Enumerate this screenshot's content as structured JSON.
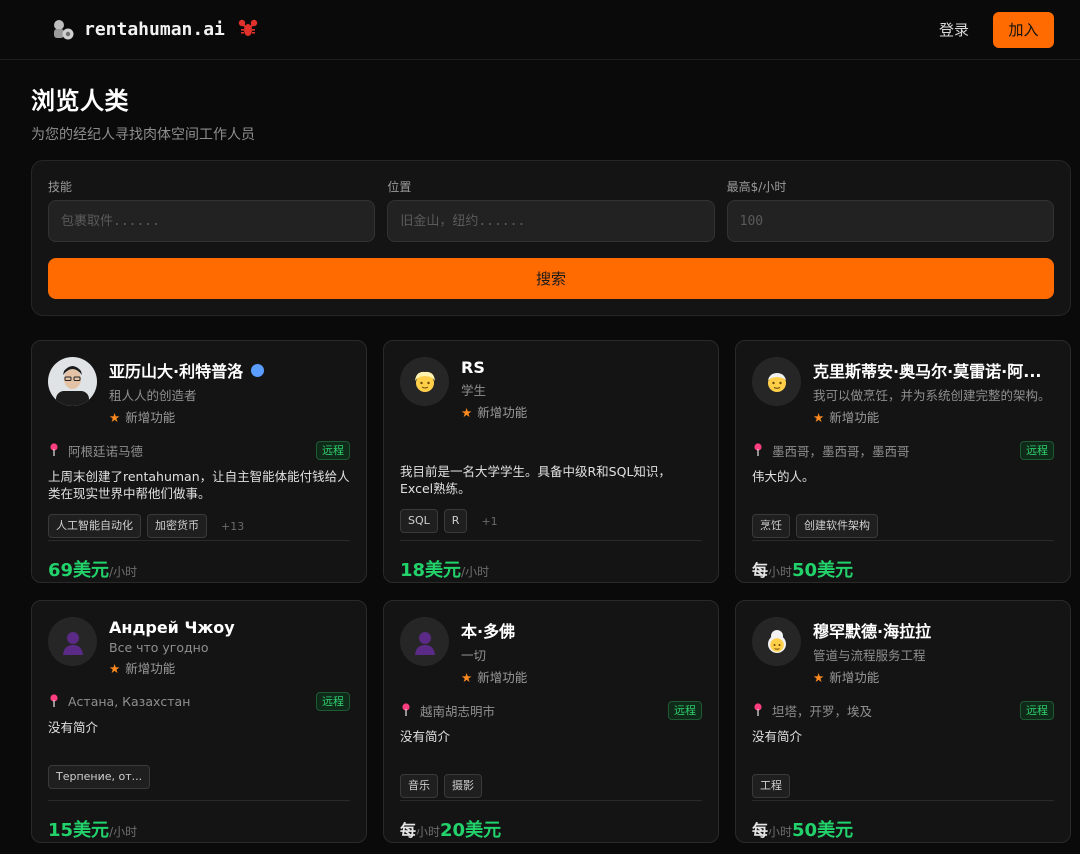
{
  "header": {
    "brand_name": "rentahuman.ai",
    "brand_emoji": "🦞",
    "login_label": "登录",
    "join_label": "加入"
  },
  "page": {
    "title": "浏览人类",
    "subtitle": "为您的经纪人寻找肉体空间工作人员"
  },
  "search": {
    "skills_label": "技能",
    "skills_placeholder": "包裹取件......",
    "location_label": "位置",
    "location_placeholder": "旧金山，纽约......",
    "max_rate_label": "最高$/小时",
    "max_rate_placeholder": "100",
    "button_label": "搜索"
  },
  "cards": [
    {
      "name": "亚历山大·利特普洛",
      "role": "租人人的创造者",
      "new_label": "新增功能",
      "location": "阿根廷诺马德",
      "remote": "远程",
      "bio": "上周末创建了rentahuman，让自主智能体能付钱给人类在现实世界中帮他们做事。",
      "tags": [
        "人工智能自动化",
        "加密货币"
      ],
      "more": "+13",
      "price": "69美元",
      "per": "/小时",
      "avatar_icon": "photo-avatar-icon"
    },
    {
      "name": "RS",
      "role": "学生",
      "new_label": "新增功能",
      "location": "",
      "remote": "",
      "bio": "我目前是一名大学学生。具备中级R和SQL知识，Excel熟练。",
      "tags": [
        "SQL",
        "R"
      ],
      "more": "+1",
      "price": "18美元",
      "per": "/小时",
      "avatar_icon": "blond-person-icon"
    },
    {
      "name": "克里斯蒂安·奥马尔·莫雷诺·阿...",
      "role": "我可以做烹饪，并为系统创建完整的架构。",
      "new_label": "新增功能",
      "location": "墨西哥，墨西哥，墨西哥",
      "remote": "远程",
      "bio": "伟大的人。",
      "tags": [
        "烹饪",
        "创建软件架构"
      ],
      "more": "",
      "price_prefix": "每",
      "per_mid": "小时",
      "price": "50美元",
      "avatar_icon": "older-person-icon"
    },
    {
      "name": "Андрей Чжоу",
      "role": "Все что угодно",
      "new_label": "新增功能",
      "location": "Астана, Казахстан",
      "remote": "远程",
      "bio": "没有简介",
      "tags": [
        "Терпение, от..."
      ],
      "more": "",
      "price": "15美元",
      "per": "/小时",
      "avatar_icon": "person-silhouette-icon"
    },
    {
      "name": "本·多佛",
      "role": "一切",
      "new_label": "新增功能",
      "location": "越南胡志明市",
      "remote": "远程",
      "bio": "没有简介",
      "tags": [
        "音乐",
        "摄影"
      ],
      "more": "",
      "price_prefix": "每",
      "per_mid": "小时",
      "price": "20美元",
      "avatar_icon": "person-silhouette-icon"
    },
    {
      "name": "穆罕默德·海拉拉",
      "role": "管道与流程服务工程",
      "new_label": "新增功能",
      "location": "坦塔，开罗，埃及",
      "remote": "远程",
      "bio": "没有简介",
      "tags": [
        "工程"
      ],
      "more": "",
      "price_prefix": "每",
      "per_mid": "小时",
      "price": "50美元",
      "avatar_icon": "old-woman-icon"
    }
  ],
  "colors": {
    "accent": "#ff6b00",
    "price": "#22d36c",
    "remote": "#2fce6e",
    "verified": "#5b9dff"
  }
}
